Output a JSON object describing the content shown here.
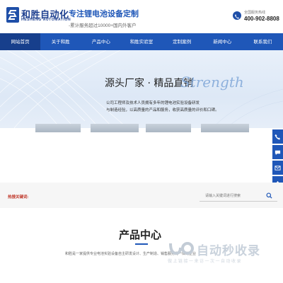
{
  "header": {
    "logo_cn": "和胜自动化",
    "logo_en": "HESHENG AUTOMATION",
    "slogan_main": "专注锂电池设备定制",
    "slogan_sub": "-累计服务超过10000+国内外客户",
    "hotline_label": "全国服务热线",
    "hotline_number": "400-902-8808"
  },
  "nav": {
    "items": [
      {
        "label": "网站首页",
        "active": true
      },
      {
        "label": "关于和胜"
      },
      {
        "label": "产品中心"
      },
      {
        "label": "和胜实验室"
      },
      {
        "label": "定制案例"
      },
      {
        "label": "新闻中心"
      },
      {
        "label": "联系我们"
      }
    ]
  },
  "banner": {
    "title": "源头厂家 · 精品直销",
    "script_text": "Strength",
    "desc_line1": "公司工程师及技术人员拥有多年的锂电池实验设备研发",
    "desc_line2": "与制造经验，以高质量的产品和服务，收获高质量的评价和口碑。"
  },
  "search": {
    "hot_label": "热搜关键词:",
    "placeholder": "请输入关键词进行搜索"
  },
  "products": {
    "title": "产品中心",
    "desc": "和胜是一家提供专业电池实验设备自主研发设计、生产制造、销售服务为一体的企业"
  },
  "watermark": {
    "text": "自动秒收录",
    "sub": "做上链接一来访一次一自动收录"
  },
  "colors": {
    "brand_blue": "#1f57b8",
    "nav_active": "#173f8c",
    "hot_red": "#c0392b"
  },
  "icons": {
    "side_buttons": [
      "phone-icon",
      "chat-icon",
      "mail-icon",
      "top-arrow-icon"
    ]
  }
}
